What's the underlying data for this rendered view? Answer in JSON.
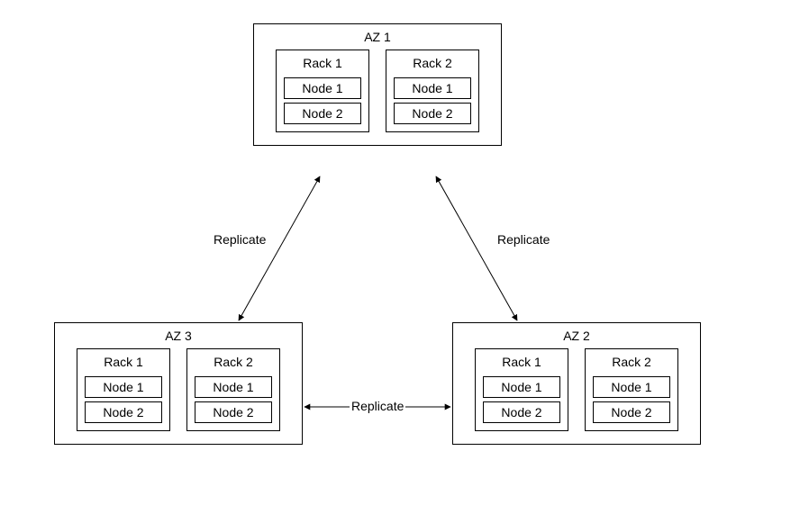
{
  "diagram": {
    "az1": {
      "title": "AZ 1",
      "rack1": {
        "title": "Rack 1",
        "node1": "Node 1",
        "node2": "Node 2"
      },
      "rack2": {
        "title": "Rack 2",
        "node1": "Node 1",
        "node2": "Node 2"
      }
    },
    "az2": {
      "title": "AZ 2",
      "rack1": {
        "title": "Rack 1",
        "node1": "Node 1",
        "node2": "Node 2"
      },
      "rack2": {
        "title": "Rack 2",
        "node1": "Node 1",
        "node2": "Node 2"
      }
    },
    "az3": {
      "title": "AZ 3",
      "rack1": {
        "title": "Rack 1",
        "node1": "Node 1",
        "node2": "Node 2"
      },
      "rack2": {
        "title": "Rack 2",
        "node1": "Node 1",
        "node2": "Node 2"
      }
    },
    "edges": {
      "az1_az3": "Replicate",
      "az1_az2": "Replicate",
      "az3_az2": "Replicate"
    }
  }
}
